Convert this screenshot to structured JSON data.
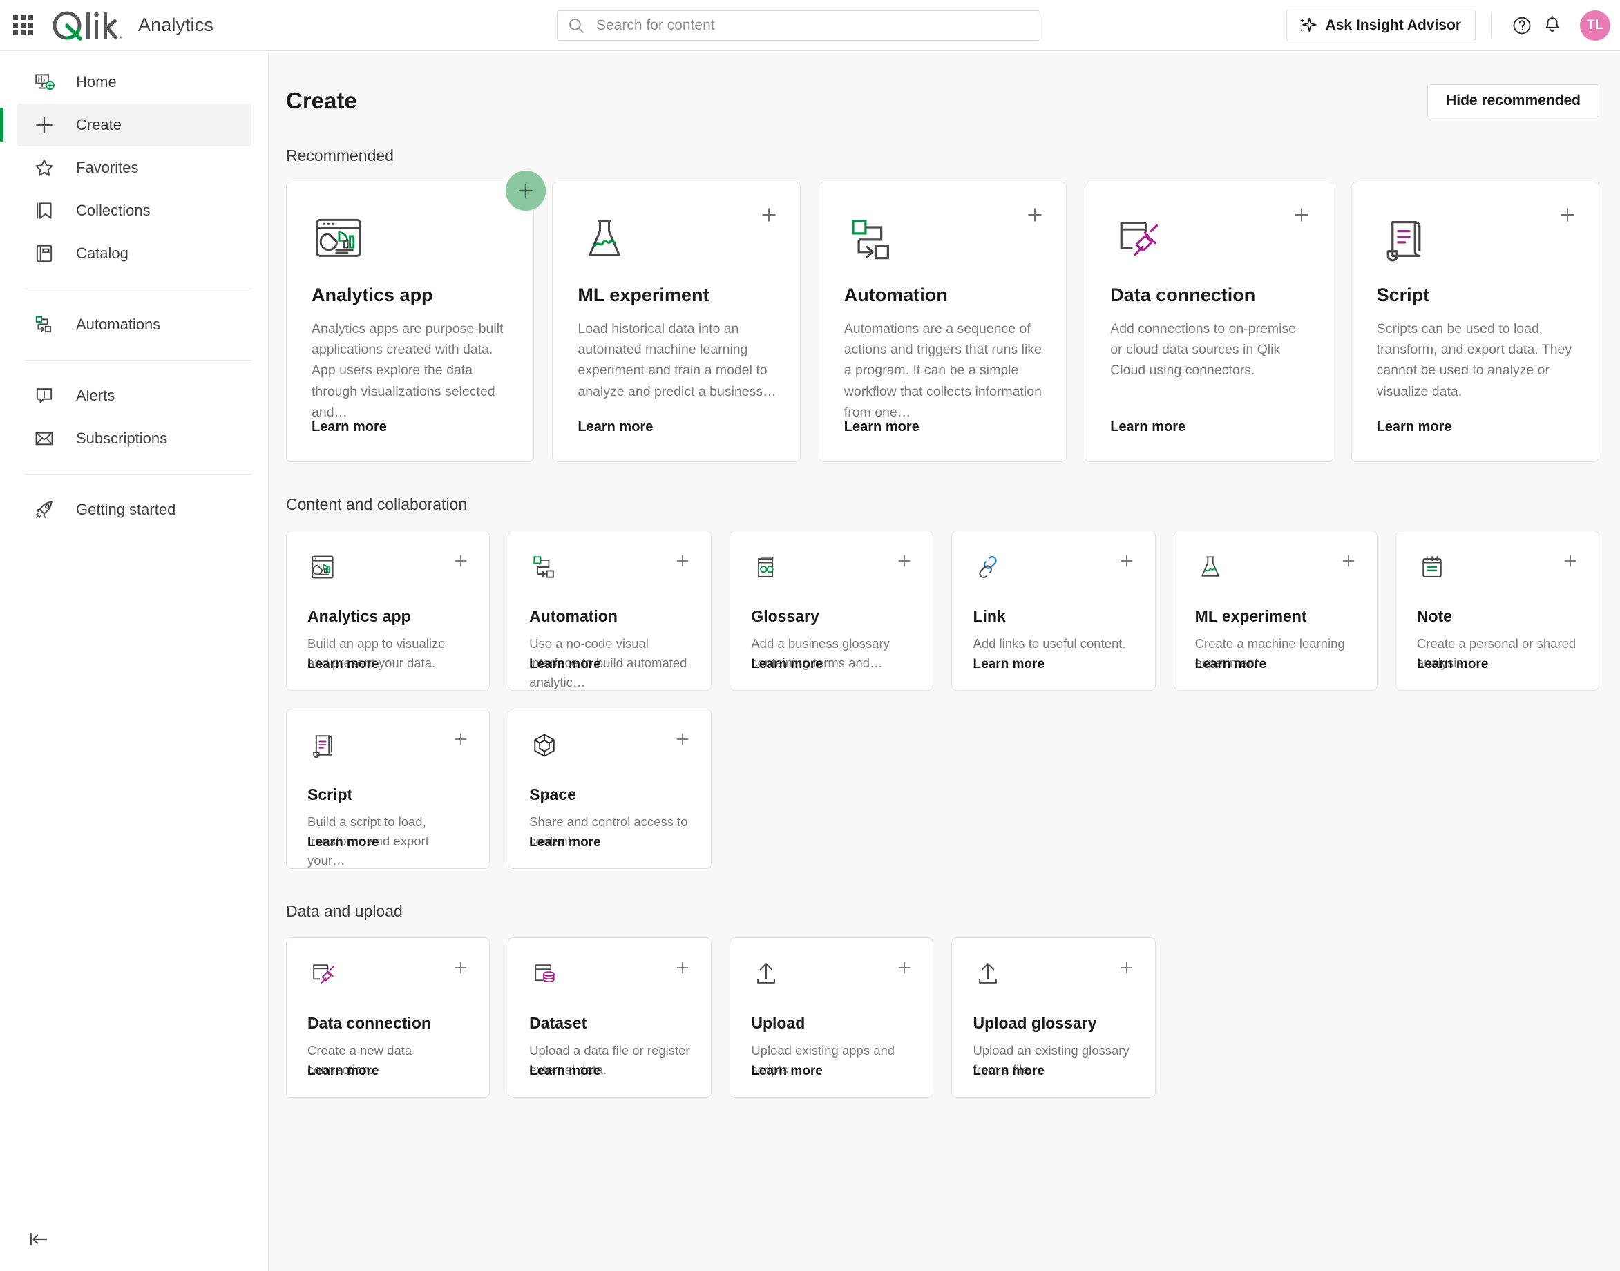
{
  "header": {
    "app_menu_icon": "waffle-grid-icon",
    "brand": "Qlik",
    "app_name": "Analytics",
    "search": {
      "placeholder": "Search for content",
      "value": ""
    },
    "insight_advisor_label": "Ask Insight Advisor",
    "insight_icon": "sparkle-icon",
    "help_icon": "help-circle-icon",
    "notification_icon": "bell-icon",
    "avatar_initials": "TL",
    "avatar_color": "#e87bb6"
  },
  "sidebar": {
    "items": [
      {
        "label": "Home",
        "icon": "home-dashboard-icon",
        "active": false
      },
      {
        "label": "Create",
        "icon": "plus-icon",
        "active": true
      },
      {
        "label": "Favorites",
        "icon": "star-icon",
        "active": false
      },
      {
        "label": "Collections",
        "icon": "bookmark-icon",
        "active": false
      },
      {
        "label": "Catalog",
        "icon": "catalog-book-icon",
        "active": false
      },
      {
        "label": "Automations",
        "icon": "automation-flow-icon",
        "active": false
      },
      {
        "label": "Alerts",
        "icon": "alert-bubble-icon",
        "active": false
      },
      {
        "label": "Subscriptions",
        "icon": "envelope-icon",
        "active": false
      },
      {
        "label": "Getting started",
        "icon": "rocket-icon",
        "active": false
      }
    ],
    "collapse_icon": "collapse-left-icon"
  },
  "main": {
    "title": "Create",
    "hide_recommended_label": "Hide recommended",
    "learn_more_label": "Learn more",
    "sections": [
      {
        "title": "Recommended",
        "cards": [
          {
            "title": "Analytics app",
            "desc": "Analytics apps are purpose-built applications created with data. App users explore the data through visualizations selected and…",
            "icon": "analytics-app-window-icon",
            "add_style": "circle-green"
          },
          {
            "title": "ML experiment",
            "desc": "Load historical data into an automated machine learning experiment and train a model to analyze and predict a business…",
            "icon": "flask-icon",
            "add_style": "plain"
          },
          {
            "title": "Automation",
            "desc": "Automations are a sequence of actions and triggers that runs like a program. It can be a simple workflow that collects information from one…",
            "icon": "automation-flow-icon",
            "add_style": "plain"
          },
          {
            "title": "Data connection",
            "desc": "Add connections to on-premise or cloud data sources in Qlik Cloud using connectors.",
            "icon": "data-connection-plug-icon",
            "add_style": "plain"
          },
          {
            "title": "Script",
            "desc": "Scripts can be used to load, transform, and export data. They cannot be used to analyze or visualize data.",
            "icon": "script-scroll-icon",
            "add_style": "plain"
          }
        ]
      },
      {
        "title": "Content and collaboration",
        "cards": [
          {
            "title": "Analytics app",
            "desc": "Build an app to visualize and present your data.",
            "icon": "analytics-app-small-icon"
          },
          {
            "title": "Automation",
            "desc": "Use a no-code visual interface to build automated analytic…",
            "icon": "automation-flow-icon"
          },
          {
            "title": "Glossary",
            "desc": "Add a business glossary containing terms and…",
            "icon": "glossary-icon"
          },
          {
            "title": "Link",
            "desc": "Add links to useful content.",
            "icon": "link-chain-icon"
          },
          {
            "title": "ML experiment",
            "desc": "Create a machine learning experiment.",
            "icon": "flask-icon"
          },
          {
            "title": "Note",
            "desc": "Create a personal or shared analysis.",
            "icon": "note-pad-icon"
          },
          {
            "title": "Script",
            "desc": "Build a script to load, transform, and export your…",
            "icon": "script-scroll-icon"
          },
          {
            "title": "Space",
            "desc": "Share and control access to content.",
            "icon": "space-cube-icon"
          }
        ]
      },
      {
        "title": "Data and upload",
        "cards": [
          {
            "title": "Data connection",
            "desc": "Create a new data connection.",
            "icon": "data-connection-plug-icon"
          },
          {
            "title": "Dataset",
            "desc": "Upload a data file or register external data.",
            "icon": "dataset-db-icon"
          },
          {
            "title": "Upload",
            "desc": "Upload existing apps and scripts.",
            "icon": "upload-arrow-icon"
          },
          {
            "title": "Upload glossary",
            "desc": "Upload an existing glossary from a file.",
            "icon": "upload-arrow-icon"
          }
        ]
      }
    ]
  },
  "colors": {
    "brand_green": "#009845",
    "accent_green": "#8ac79f",
    "magenta": "#a9228f",
    "blue": "#1a87c9",
    "text_dark": "#1a1a1a",
    "text_muted": "#7a7a7a"
  }
}
